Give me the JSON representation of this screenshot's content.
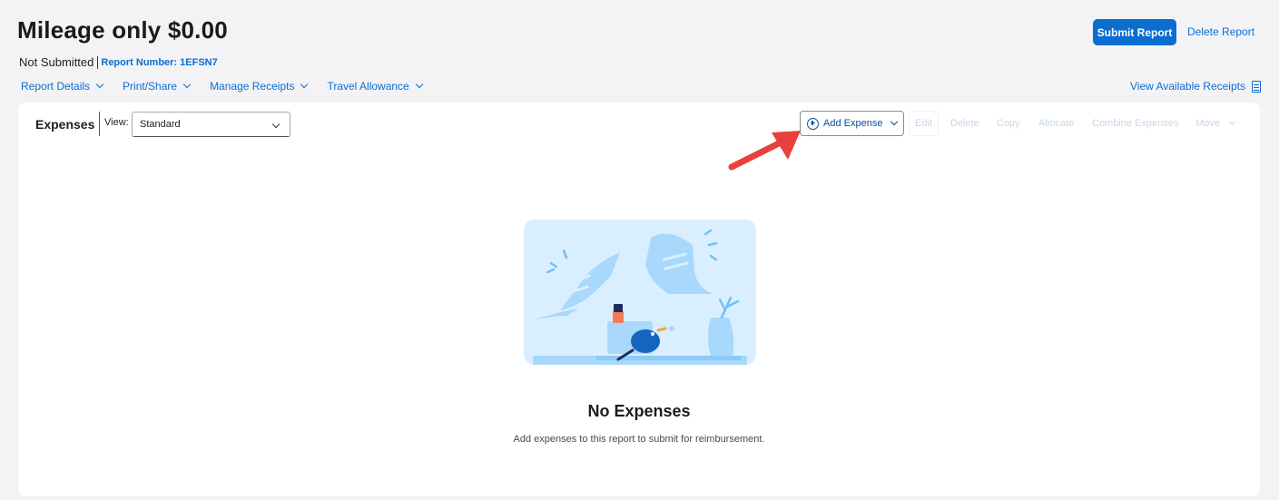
{
  "header": {
    "title": "Mileage only $0.00",
    "status": "Not Submitted",
    "report_number_label": "Report Number:",
    "report_number": "1EFSN7",
    "submit_label": "Submit Report",
    "delete_label": "Delete Report"
  },
  "menu": {
    "items": [
      {
        "label": "Report Details"
      },
      {
        "label": "Print/Share"
      },
      {
        "label": "Manage Receipts"
      },
      {
        "label": "Travel Allowance"
      }
    ],
    "view_receipts": "View Available Receipts"
  },
  "expenses": {
    "title": "Expenses",
    "view_label": "View:",
    "view_value": "Standard",
    "add_expense": "Add Expense",
    "actions": {
      "edit": "Edit",
      "delete": "Delete",
      "copy": "Copy",
      "allocate": "Allocate",
      "combine": "Combine Expenses",
      "move": "Move"
    },
    "empty_title": "No Expenses",
    "empty_subtitle": "Add expenses to this report to submit for reimbursement."
  },
  "colors": {
    "accent": "#0a6ed1",
    "annotation_arrow": "#e8403b"
  }
}
